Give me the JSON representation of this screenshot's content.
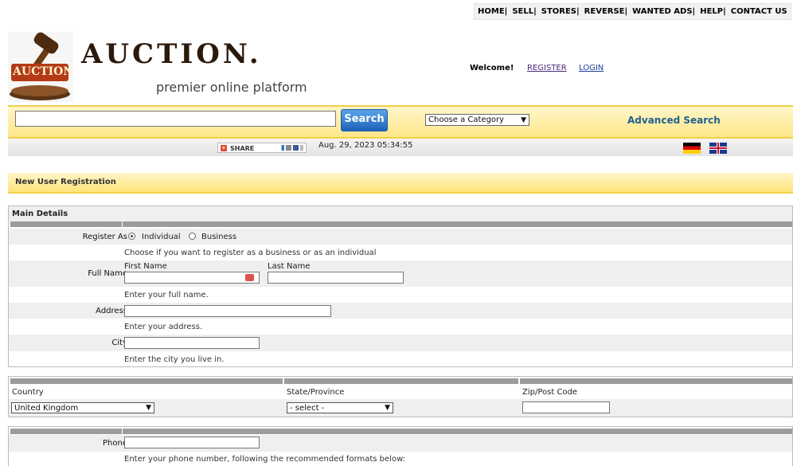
{
  "topnav": [
    "HOME|",
    "SELL|",
    "STORES|",
    "REVERSE|",
    "WANTED ADS|",
    "HELP|",
    "CONTACT US"
  ],
  "header": {
    "logo_badge": "AUCTION",
    "logo_title": "AUCTION.",
    "tagline": "premier online platform",
    "welcome": "Welcome!",
    "register": "REGISTER",
    "login": "LOGIN"
  },
  "search": {
    "button": "Search",
    "category": "Choose a Category",
    "advanced": "Advanced Search"
  },
  "infobar": {
    "share": "SHARE",
    "datetime": "Aug. 29, 2023 05:34:55"
  },
  "section": {
    "title": "New User Registration"
  },
  "main_details": {
    "heading": "Main Details",
    "register_as_label": "Register As",
    "individual": "Individual",
    "business": "Business",
    "register_as_hint": "Choose if you want to register as a business or as an individual",
    "full_name_label": "Full Name",
    "first_name": "First Name",
    "last_name": "Last Name",
    "full_name_hint": "Enter your full name.",
    "address_label": "Address",
    "address_hint": "Enter your address.",
    "city_label": "City",
    "city_hint": "Enter the city you live in."
  },
  "location": {
    "country_label": "Country",
    "state_label": "State/Province",
    "zip_label": "Zip/Post Code",
    "country_value": "United Kingdom",
    "state_value": "- select -"
  },
  "phone": {
    "label": "Phone",
    "hint": "Enter your phone number, following the recommended formats below:"
  }
}
